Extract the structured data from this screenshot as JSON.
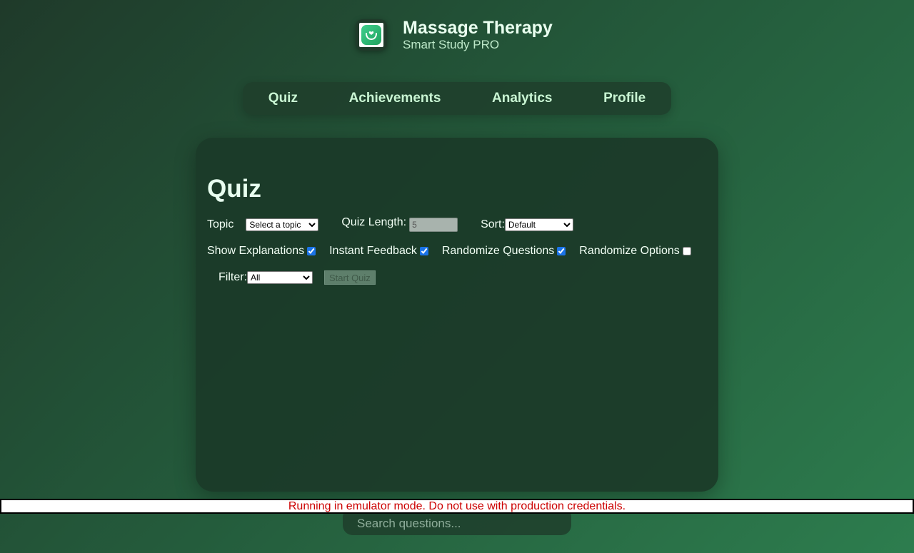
{
  "app": {
    "title": "Massage Therapy",
    "subtitle": "Smart Study PRO",
    "logo_icon": "hands-holding-heart-icon"
  },
  "nav": {
    "tabs": [
      {
        "label": "Quiz"
      },
      {
        "label": "Achievements"
      },
      {
        "label": "Analytics"
      },
      {
        "label": "Profile"
      }
    ]
  },
  "quiz": {
    "title": "Quiz",
    "topic_label": "Topic",
    "topic_selected": "Select a topic",
    "length_label": "Quiz Length:",
    "length_value": "5",
    "sort_label": "Sort:",
    "sort_selected": "Default",
    "show_explanations_label": "Show Explanations",
    "show_explanations_checked": true,
    "instant_feedback_label": "Instant Feedback",
    "instant_feedback_checked": true,
    "randomize_questions_label": "Randomize Questions",
    "randomize_questions_checked": true,
    "randomize_options_label": "Randomize Options",
    "randomize_options_checked": false,
    "filter_label": "Filter:",
    "filter_selected": "All",
    "start_button": "Start Quiz"
  },
  "warning": "Running in emulator mode. Do not use with production credentials.",
  "search": {
    "placeholder": "Search questions..."
  },
  "colors": {
    "bg_start": "#1f3a2a",
    "bg_end": "#2d7d4e",
    "nav_text": "#c9f5d3",
    "warning_text": "#cc0000"
  }
}
